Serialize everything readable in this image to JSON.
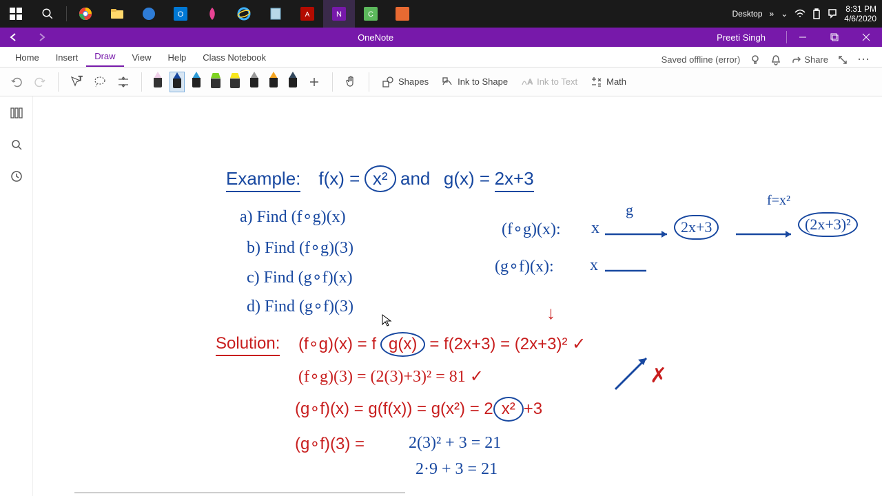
{
  "taskbar": {
    "desktop_label": "Desktop",
    "time": "8:31 PM",
    "date": "4/6/2020"
  },
  "titlebar": {
    "app_name": "OneNote",
    "user": "Preeti Singh"
  },
  "ribbon": {
    "tabs": [
      "Home",
      "Insert",
      "Draw",
      "View",
      "Help",
      "Class Notebook"
    ],
    "status": "Saved offline (error)",
    "share": "Share"
  },
  "toolbar": {
    "shapes": "Shapes",
    "ink_to_shape": "Ink to Shape",
    "ink_to_text": "Ink to Text",
    "math": "Math"
  },
  "notes": {
    "example": "Example:",
    "fx": "f(x) =",
    "x2": "x²",
    "and": "and",
    "gx": "g(x) =",
    "gx_expr": "2x+3",
    "a": "a)  Find  (f∘g)(x)",
    "b": "b)  Find  (f∘g)(3)",
    "c": "c)  Find  (g∘f)(x)",
    "d": "d)  Find  (g∘f)(3)",
    "solution": "Solution:",
    "fog_lhs": "(f∘g)(x):",
    "x_sym": "x",
    "g_lbl": "g",
    "box1": "2x+3",
    "fx2_lbl": "f=x²",
    "box2": "(2x+3)²",
    "gof_lhs": "(g∘f)(x):",
    "sol1": "(f∘g)(x) =  f",
    "gx_circ": "g(x)",
    "sol1b": "= f(2x+3) = (2x+3)² ✓",
    "arrow_down": "↓",
    "sol2": "(f∘g)(3) = (2(3)+3)² = 81  ✓",
    "sol3": "(g∘f)(x) =  g(f(x)) = g(x²) = 2",
    "x2_circ": "x²",
    "sol3b": "+3",
    "cross": "✗",
    "sol4": "(g∘f)(3) =  2(3)² + 3 = 21",
    "sol5": "2·9 + 3 = 21"
  }
}
